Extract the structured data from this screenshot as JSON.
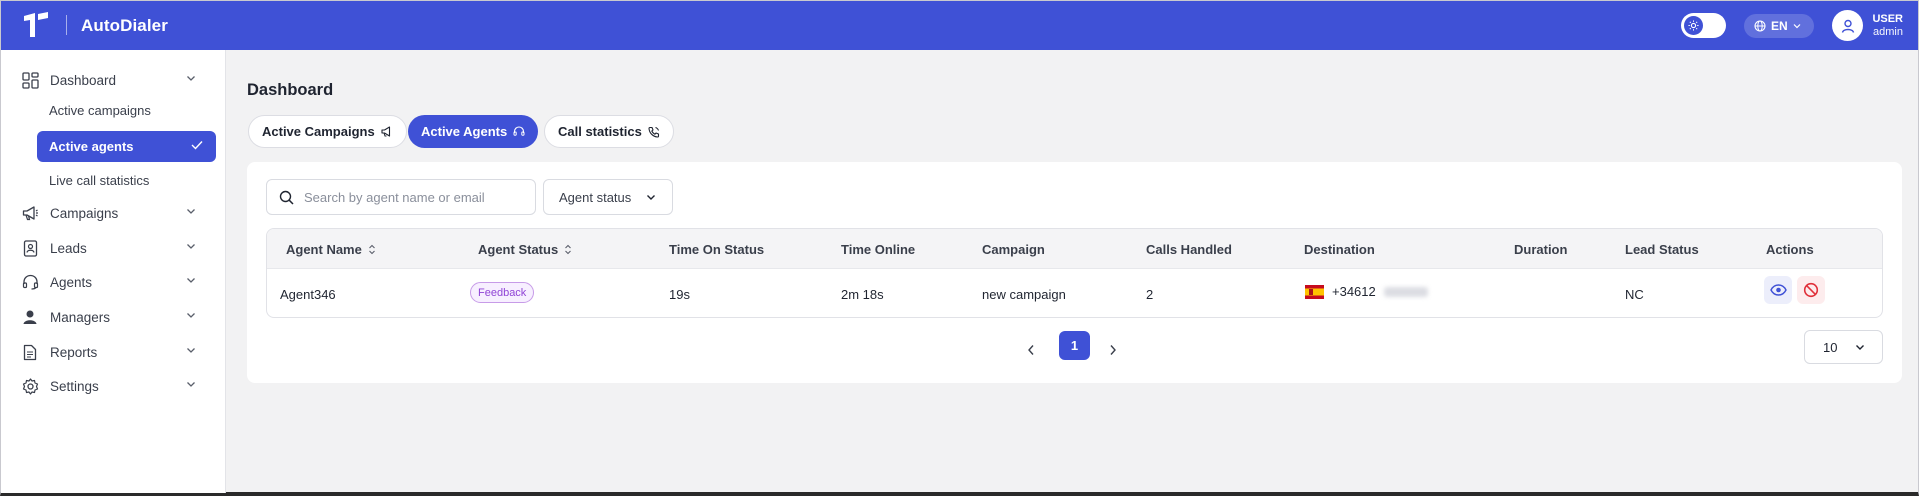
{
  "header": {
    "app_name": "AutoDialer",
    "language": "EN",
    "user_label": "USER",
    "user_role": "admin"
  },
  "sidebar": {
    "items": [
      {
        "label": "Dashboard",
        "icon": "dashboard-icon"
      },
      {
        "label": "Campaigns",
        "icon": "megaphone-icon"
      },
      {
        "label": "Leads",
        "icon": "contact-book-icon"
      },
      {
        "label": "Agents",
        "icon": "headset-icon"
      },
      {
        "label": "Managers",
        "icon": "person-icon"
      },
      {
        "label": "Reports",
        "icon": "document-icon"
      },
      {
        "label": "Settings",
        "icon": "gear-icon"
      }
    ],
    "dashboard_sub": [
      {
        "label": "Active campaigns"
      },
      {
        "label": "Active agents"
      },
      {
        "label": "Live call statistics"
      }
    ]
  },
  "page": {
    "title": "Dashboard",
    "tabs": [
      {
        "label": "Active Campaigns"
      },
      {
        "label": "Active Agents"
      },
      {
        "label": "Call statistics"
      }
    ]
  },
  "filters": {
    "search_placeholder": "Search by agent name or email",
    "status_label": "Agent status"
  },
  "table": {
    "columns": [
      "Agent Name",
      "Agent Status",
      "Time On Status",
      "Time Online",
      "Campaign",
      "Calls Handled",
      "Destination",
      "Duration",
      "Lead Status",
      "Actions"
    ],
    "rows": [
      {
        "agent_name": "Agent346",
        "agent_status": "Feedback",
        "time_on_status": "19s",
        "time_online": "2m 18s",
        "campaign": "new campaign",
        "calls_handled": "2",
        "destination": "+34612",
        "duration": "",
        "lead_status": "NC"
      }
    ]
  },
  "pagination": {
    "current_page": "1",
    "page_size": "10"
  },
  "colors": {
    "primary": "#3f51d6",
    "badge_purple": "#9044d6",
    "danger": "#e0303a"
  }
}
